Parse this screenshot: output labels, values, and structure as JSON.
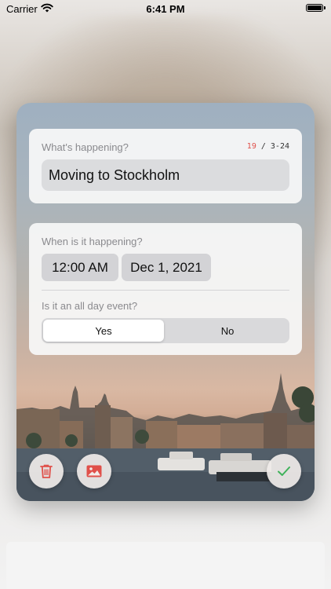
{
  "status_bar": {
    "carrier": "Carrier",
    "time": "6:41 PM"
  },
  "form": {
    "title_section": {
      "label": "What's happening?",
      "char_count": "19",
      "char_range": "/ 3-24",
      "value": "Moving to Stockholm"
    },
    "date_section": {
      "label": "When is it happening?",
      "time_value": "12:00 AM",
      "date_value": "Dec 1, 2021",
      "all_day_label": "Is it an all day event?",
      "all_day_options": [
        "Yes",
        "No"
      ],
      "all_day_selected": "Yes"
    }
  },
  "actions": {
    "delete_icon": "trash-icon",
    "image_icon": "photo-icon",
    "confirm_icon": "checkmark-icon"
  },
  "colors": {
    "counter_accent": "#e0504a",
    "delete_red": "#e0504a",
    "confirm_green": "#3fb25a"
  }
}
